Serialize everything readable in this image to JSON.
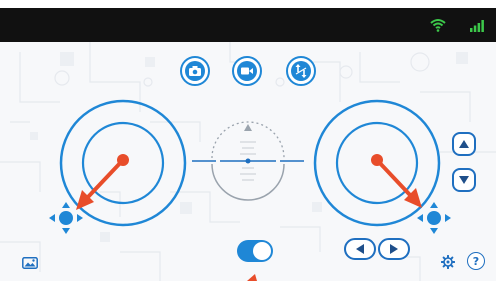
{
  "header": {
    "icons": [
      "wifi-icon",
      "signal-bars-icon"
    ],
    "bg": "#111111",
    "icon_color": "#3cc84a"
  },
  "toolbar": {
    "buttons": [
      "camera-icon",
      "video-camera-icon",
      "drone-flip-icon"
    ],
    "accent": "#1f87d6"
  },
  "left_joystick": {
    "stick_color": "#e84d2a",
    "ring_color": "#1f87d6"
  },
  "right_joystick": {
    "stick_color": "#e84d2a",
    "ring_color": "#1f87d6"
  },
  "right_controls": {
    "up": "triangle-up-icon",
    "down": "triangle-down-icon",
    "left": "triangle-left-icon",
    "right": "triangle-right-icon"
  },
  "toggle": {
    "on": true
  },
  "help": {
    "label": "?"
  },
  "footer_icons": [
    "gallery-icon",
    "settings-gear-icon",
    "help-icon"
  ]
}
